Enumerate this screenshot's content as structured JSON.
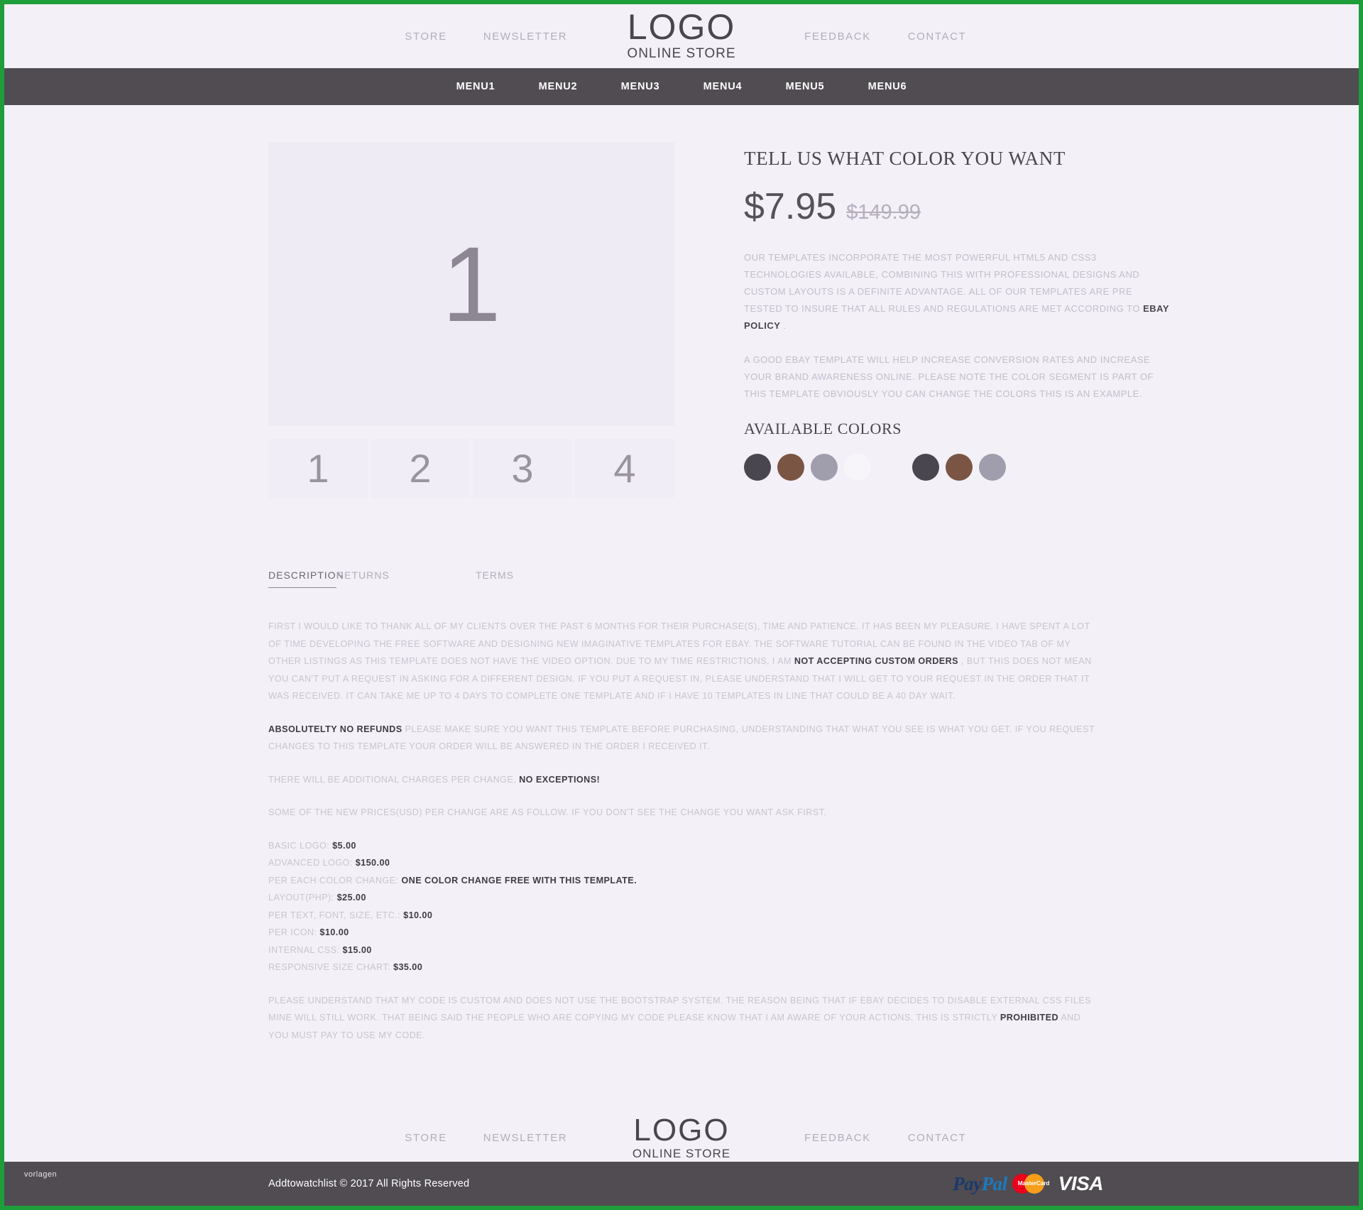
{
  "brand": {
    "logo_main": "LOGO",
    "logo_sub": "ONLINE STORE"
  },
  "header": {
    "links": [
      {
        "label": "STORE"
      },
      {
        "label": "NEWSLETTER"
      },
      {
        "label": "FEEDBACK"
      },
      {
        "label": "CONTACT"
      }
    ]
  },
  "menubar": {
    "items": [
      {
        "label": "MENU1"
      },
      {
        "label": "MENU2"
      },
      {
        "label": "MENU3"
      },
      {
        "label": "MENU4"
      },
      {
        "label": "MENU5"
      },
      {
        "label": "MENU6"
      }
    ]
  },
  "gallery": {
    "main_label": "1",
    "thumbs": [
      {
        "label": "1"
      },
      {
        "label": "2"
      },
      {
        "label": "3"
      },
      {
        "label": "4"
      }
    ]
  },
  "product": {
    "title": "TELL US WHAT COLOR YOU WANT",
    "price_now": "$7.95",
    "price_old": "$149.99",
    "para1_a": "OUR TEMPLATES INCORPORATE THE MOST POWERFUL HTML5 AND CSS3 TECHNOLOGIES AVAILABLE, COMBINING THIS WITH PROFESSIONAL DESIGNS AND CUSTOM LAYOUTS IS A DEFINITE ADVANTAGE. ALL OF OUR TEMPLATES ARE PRE TESTED TO INSURE THAT ALL RULES AND REGULATIONS ARE MET ACCORDING TO ",
    "para1_bold": "EBAY POLICY",
    "para1_b": " .",
    "para2": "A GOOD EBAY TEMPLATE WILL HELP INCREASE CONVERSION RATES AND INCREASE YOUR BRAND AWARENESS ONLINE. PLEASE NOTE THE COLOR SEGMENT IS PART OF THIS TEMPLATE OBVIOUSLY YOU CAN CHANGE THE COLORS THIS IS AN EXAMPLE.",
    "colors_title": "AVAILABLE COLORS",
    "swatch_group_1": [
      "#4a4650",
      "#7a5543",
      "#a09ead",
      "#f7f5fa"
    ],
    "swatch_group_2": [
      "#4a4650",
      "#7a5543",
      "#a09ead"
    ]
  },
  "tabs": [
    {
      "label": "DESCRIPTION",
      "active": true
    },
    {
      "label": "RETURNS",
      "active": false
    },
    {
      "label": "TERMS",
      "active": false
    }
  ],
  "description": {
    "p1_a": "FIRST I WOULD LIKE TO THANK ALL OF MY CLIENTS OVER THE PAST 6 MONTHS FOR THEIR PURCHASE(S), TIME AND PATIENCE. IT HAS BEEN MY PLEASURE. I HAVE SPENT A LOT OF TIME DEVELOPING THE FREE SOFTWARE AND DESIGNING NEW IMAGINATIVE TEMPLATES FOR EBAY. THE SOFTWARE TUTORIAL CAN BE FOUND IN THE VIDEO TAB OF MY OTHER LISTINGS AS THIS TEMPLATE DOES NOT HAVE THE VIDEO OPTION. DUE TO MY TIME RESTRICTIONS, I AM ",
    "p1_bold": "NOT ACCEPTING CUSTOM ORDERS",
    "p1_b": " , BUT THIS DOES NOT MEAN YOU CAN'T PUT A REQUEST IN ASKING FOR A DIFFERENT DESIGN. IF YOU PUT A REQUEST IN, PLEASE UNDERSTAND THAT I WILL GET TO YOUR REQUEST IN THE ORDER THAT IT WAS RECEIVED. IT CAN TAKE ME UP TO 4 DAYS TO COMPLETE ONE TEMPLATE AND IF I HAVE 10 TEMPLATES IN LINE THAT COULD BE A 40 DAY WAIT.",
    "p2_bold": "ABSOLUTELTY NO REFUNDS",
    "p2_b": " PLEASE MAKE SURE YOU WANT THIS TEMPLATE BEFORE PURCHASING, UNDERSTANDING THAT WHAT YOU SEE IS WHAT YOU GET. IF YOU REQUEST CHANGES TO THIS TEMPLATE YOUR ORDER WILL BE ANSWERED IN THE ORDER I RECEIVED IT.",
    "p3_a": "THERE WILL BE ADDITIONAL CHARGES PER CHANGE, ",
    "p3_bold": "NO EXCEPTIONS!",
    "p4": "SOME OF THE NEW PRICES(USD) PER CHANGE ARE AS FOLLOW. IF YOU DON'T SEE THE CHANGE YOU WANT ASK FIRST.",
    "price_list": [
      {
        "label": "BASIC LOGO: ",
        "value": "$5.00"
      },
      {
        "label": "ADVANCED LOGO: ",
        "value": "$150.00"
      },
      {
        "label": "PER EACH COLOR CHANGE: ",
        "value": "ONE COLOR CHANGE FREE WITH THIS TEMPLATE."
      },
      {
        "label": "LAYOUT(PHP): ",
        "value": "$25.00"
      },
      {
        "label": "PER TEXT, FONT, SIZE, ETC.: ",
        "value": "$10.00"
      },
      {
        "label": "PER ICON: ",
        "value": "$10.00"
      },
      {
        "label": "INTERNAL CSS: ",
        "value": "$15.00"
      },
      {
        "label": "RESPONSIVE SIZE CHART: ",
        "value": "$35.00"
      }
    ],
    "p5_a": "PLEASE UNDERSTAND THAT MY CODE IS CUSTOM AND DOES NOT USE THE BOOTSTRAP SYSTEM. THE REASON BEING THAT IF EBAY DECIDES TO DISABLE EXTERNAL CSS FILES MINE WILL STILL WORK. THAT BEING SAID THE PEOPLE WHO ARE COPYING MY CODE PLEASE KNOW THAT I AM AWARE OF YOUR ACTIONS. THIS IS STRICTLY ",
    "p5_bold": "PROHIBITED",
    "p5_b": " AND YOU MUST PAY TO USE MY CODE."
  },
  "footer": {
    "links": [
      {
        "label": "STORE"
      },
      {
        "label": "NEWSLETTER"
      },
      {
        "label": "FEEDBACK"
      },
      {
        "label": "CONTACT"
      }
    ],
    "copyright": "Addtowatchlist © 2017 All Rights Reserved",
    "watermark": "vorlagen",
    "payments": {
      "paypal_1": "Pay",
      "paypal_2": "Pal",
      "mastercard": "MasterCard",
      "visa": "VISA"
    }
  },
  "colors": {
    "accent_border": "#1e9e3a",
    "background": "#f3f0f7",
    "navbar": "#504c52"
  }
}
